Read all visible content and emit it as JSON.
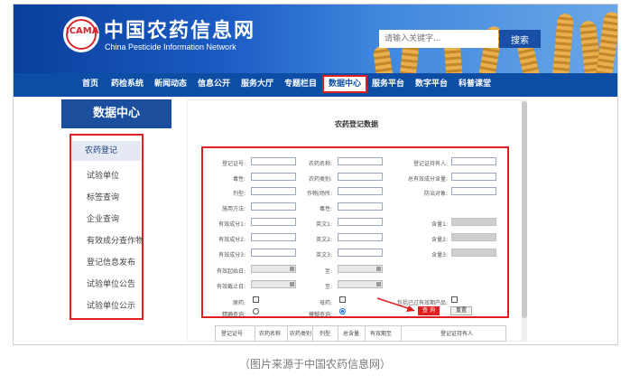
{
  "header": {
    "logo_mark": "ICAMA",
    "site_title": "中国农药信息网",
    "site_subtitle": "China Pesticide Information Network",
    "search_placeholder": "请输入关键字...",
    "search_button": "搜索"
  },
  "nav": {
    "items": [
      "首页",
      "药检系统",
      "新闻动态",
      "信息公开",
      "服务大厅",
      "专题栏目",
      "数据中心",
      "服务平台",
      "数字平台",
      "科普课堂"
    ],
    "active": "数据中心"
  },
  "sidebar": {
    "title": "数据中心",
    "items": [
      "农药登记",
      "试验单位",
      "标签查询",
      "企业查询",
      "有效成分查作物",
      "登记信息发布",
      "试验单位公告",
      "试验单位公示"
    ]
  },
  "panel": {
    "title": "农药登记数据"
  },
  "form": {
    "fields": {
      "reg_no": "登记证号:",
      "pesticide_name": "农药名称:",
      "holder": "登记证持有人:",
      "toxicity": "毒性:",
      "category": "农药类别:",
      "total_content": "总有效成分含量:",
      "formulation": "剂型:",
      "crop_site": "作物/场所:",
      "target": "防治对象:",
      "method": "施用方法:",
      "component1": "有效成分1:",
      "component2": "有效成分2:",
      "component3": "有效成分3:",
      "en1": "英文1:",
      "en2": "英文2:",
      "en3": "英文3:",
      "content1": "含量1:",
      "content2": "含量2:",
      "content3": "含量3:",
      "start_date": "有效起始日:",
      "end_date": "有效截止日:",
      "to1": "至:",
      "to2": "至:",
      "exact": "原药:",
      "fuzzy": "母药:",
      "valid_only": "包括已过有效期产品:",
      "exact_query": "精确查询:",
      "fuzzy_query": "模糊查询:"
    },
    "fuzzy_query_checked": true,
    "query_button": "查 询",
    "reset_button": "重置"
  },
  "result_table": {
    "columns": [
      "登记证号",
      "农药名称",
      "农药类别",
      "剂型",
      "总含量",
      "有效期至",
      "登记证持有人"
    ]
  },
  "caption": "（图片来源于中国农药信息网）",
  "colors": {
    "nav_blue": "#0c4ea6",
    "highlight_red": "#e02020",
    "sidebar_head": "#1b4f9e"
  }
}
